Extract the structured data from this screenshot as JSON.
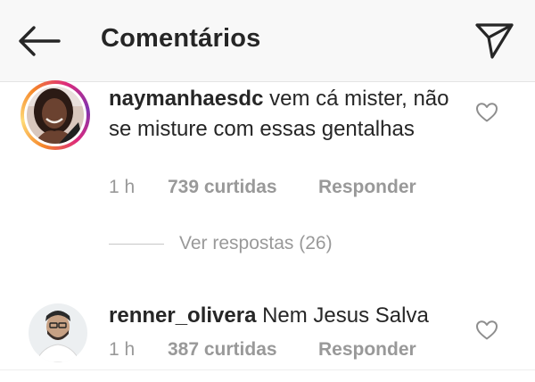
{
  "header": {
    "title": "Comentários",
    "back_icon": "arrow-left-icon",
    "send_icon": "paper-plane-icon"
  },
  "comments": [
    {
      "username": "naymanhaesdc",
      "text": "vem cá mister, não se misture com essas gentalhas",
      "time": "1 h",
      "likes": "739 curtidas",
      "reply": "Responder",
      "has_story_ring": true
    },
    {
      "username": "renner_olivera",
      "text": "Nem Jesus Salva",
      "time": "1 h",
      "likes": "387 curtidas",
      "reply": "Responder",
      "has_story_ring": false
    }
  ],
  "view_replies": "Ver respostas (26)",
  "colors": {
    "text": "#262626",
    "muted": "#999999",
    "header_bg": "#f8f8f8",
    "story_ring": [
      "#f58529",
      "#dd2a7b",
      "#8134af"
    ]
  }
}
